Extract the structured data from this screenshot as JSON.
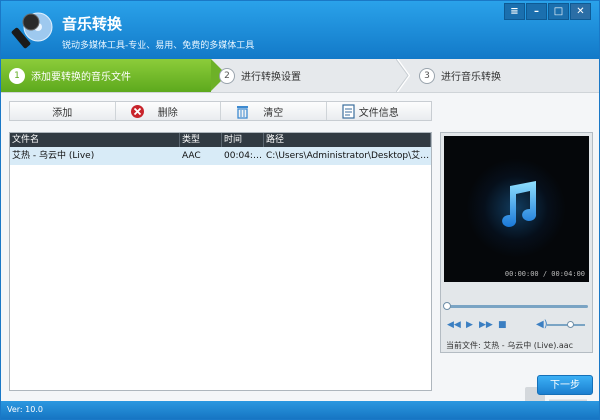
{
  "app": {
    "title": "音乐转换",
    "subtitle": "锐动多媒体工具-专业、易用、免费的多媒体工具",
    "window_controls": [
      "menu",
      "minimize",
      "maximize",
      "close"
    ],
    "brand_color": "#1a8ad6"
  },
  "steps": [
    {
      "num": "1",
      "label": "添加要转换的音乐文件",
      "active": true
    },
    {
      "num": "2",
      "label": "进行转换设置",
      "active": false
    },
    {
      "num": "3",
      "label": "进行音乐转换",
      "active": false
    }
  ],
  "toolbar": {
    "add_label": "添加",
    "delete_label": "删除",
    "clear_label": "清空",
    "info_label": "文件信息"
  },
  "table": {
    "headers": [
      "文件名",
      "类型",
      "时间",
      "路径"
    ],
    "rows": [
      {
        "name": "艾热 - 乌云中 (Live)",
        "type": "AAC",
        "time": "00:04:10",
        "path": "C:\\Users\\Administrator\\Desktop\\艾热 - ..."
      }
    ]
  },
  "player": {
    "time": "00:00:00 / 00:04:00",
    "current_file": "当前文件: 艾热 - 乌云中 (Live).aac",
    "icons": [
      "prev-icon",
      "play-icon",
      "next-icon",
      "stop-icon",
      "volume-icon"
    ],
    "seek_fraction": 0,
    "volume_fraction": 0.6
  },
  "next_button": "下一步",
  "status": {
    "version": "Ver: 10.0"
  }
}
